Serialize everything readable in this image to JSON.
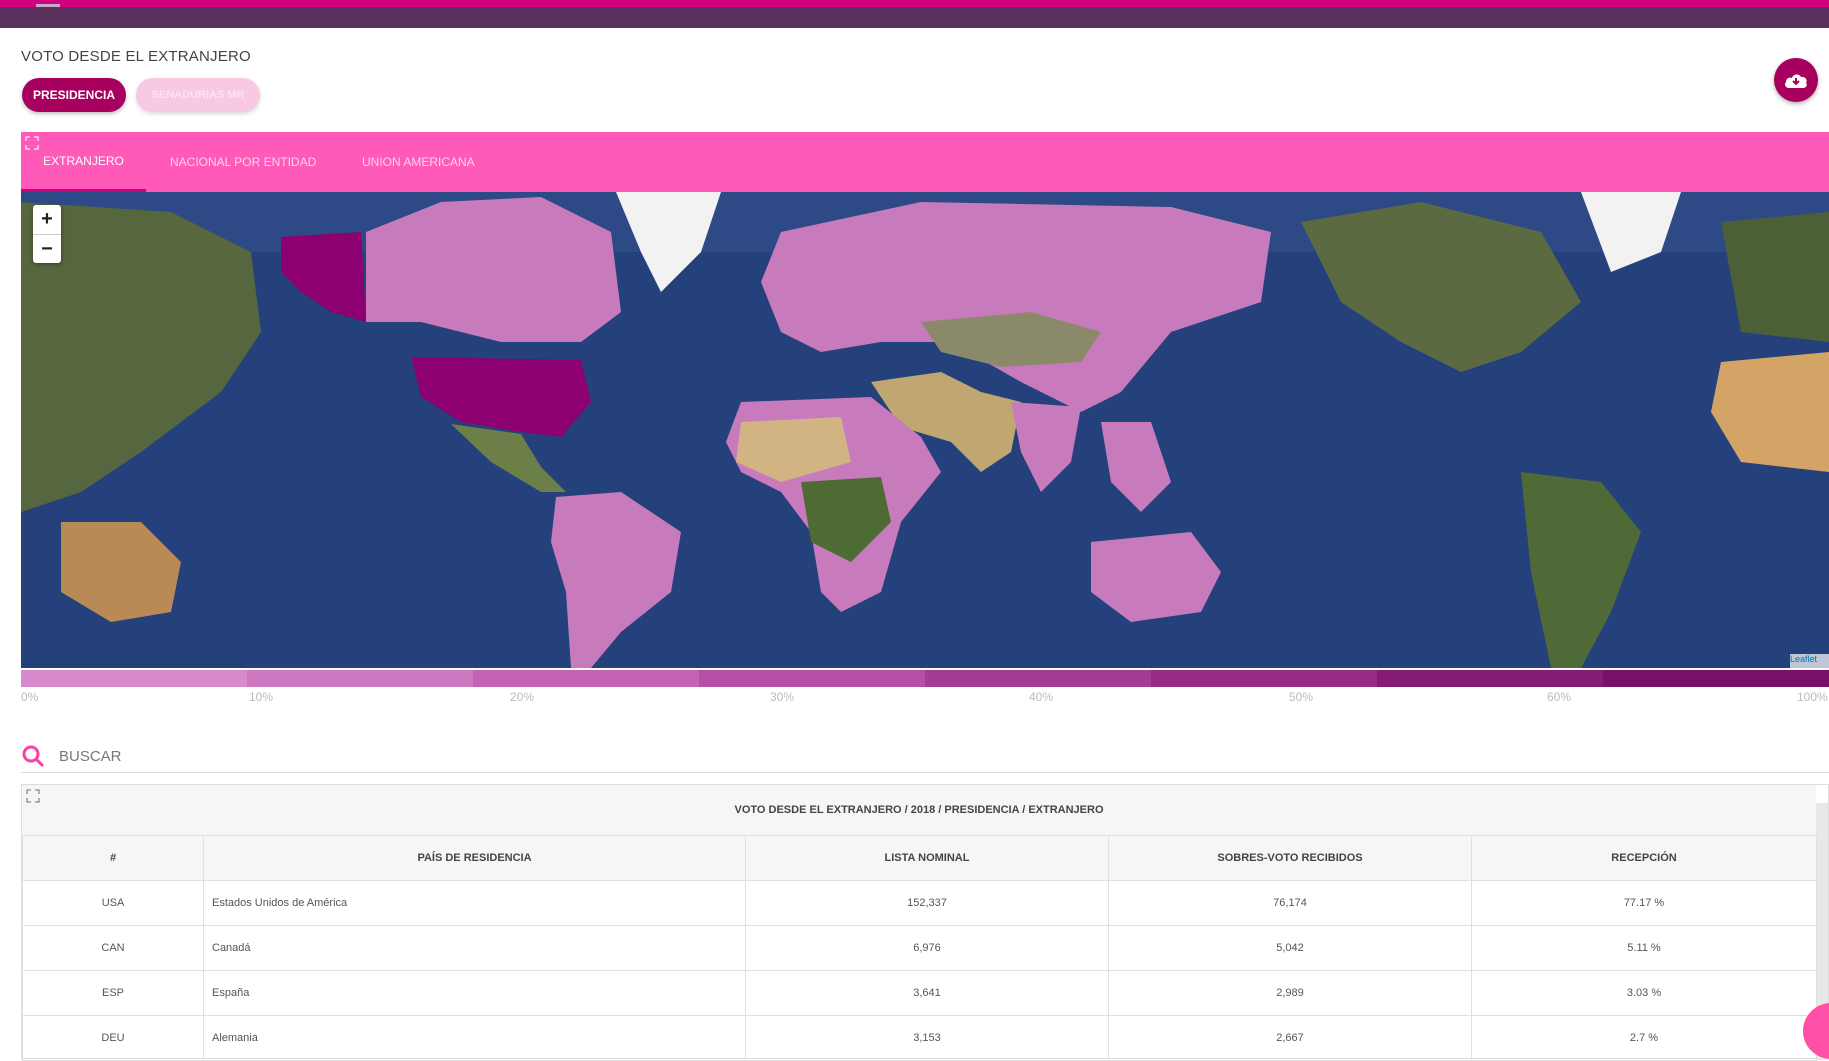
{
  "header": {
    "title": "VOTO DESDE EL EXTRANJERO"
  },
  "buttons": {
    "presidencia": "PRESIDENCIA",
    "senadurias": "SENADURIAS MR"
  },
  "tabs": [
    {
      "label": "EXTRANJERO",
      "active": true
    },
    {
      "label": "NACIONAL POR ENTIDAD",
      "active": false
    },
    {
      "label": "UNION AMERICANA",
      "active": false
    }
  ],
  "map": {
    "zoom_in": "+",
    "zoom_out": "−",
    "attribution": "Leaflet"
  },
  "legend": {
    "labels": [
      "0%",
      "10%",
      "20%",
      "30%",
      "40%",
      "50%",
      "60%",
      "100%"
    ],
    "colors": [
      "#d88bcc",
      "#cf78c2",
      "#c463b5",
      "#b64ea6",
      "#a63b96",
      "#962a86",
      "#861b77",
      "#780f6a"
    ]
  },
  "search": {
    "label": "BUSCAR"
  },
  "table": {
    "caption": "VOTO DESDE EL EXTRANJERO / 2018 / PRESIDENCIA / EXTRANJERO",
    "headers": [
      "#",
      "PAÍS DE RESIDENCIA",
      "LISTA NOMINAL",
      "SOBRES-VOTO RECIBIDOS",
      "RECEPCIÓN"
    ],
    "rows": [
      [
        "USA",
        "Estados Unidos de América",
        "152,337",
        "76,174",
        "77.17 %"
      ],
      [
        "CAN",
        "Canadá",
        "6,976",
        "5,042",
        "5.11 %"
      ],
      [
        "ESP",
        "España",
        "3,641",
        "2,989",
        "3.03 %"
      ],
      [
        "DEU",
        "Alemania",
        "3,153",
        "2,667",
        "2.7 %"
      ]
    ]
  },
  "colors": {
    "accent": "#a8005f",
    "tab_bar": "#ff5ab9",
    "top_bar": "#5b2f5e",
    "country_fill": "#c77bbd",
    "country_high": "#8d006f"
  }
}
